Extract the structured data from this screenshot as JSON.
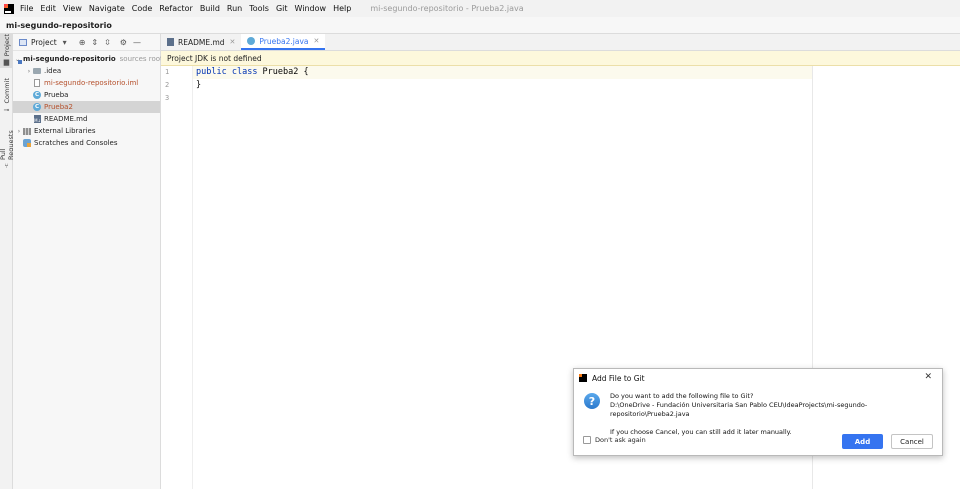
{
  "menubar": {
    "items": [
      "File",
      "Edit",
      "View",
      "Navigate",
      "Code",
      "Refactor",
      "Build",
      "Run",
      "Tools",
      "Git",
      "Window",
      "Help"
    ],
    "window_title": "mi-segundo-repositorio - Prueba2.java"
  },
  "navbar": {
    "project_name": "mi-segundo-repositorio"
  },
  "toolstrip": {
    "tabs": [
      {
        "label": "Project",
        "icon": "folder-icon"
      },
      {
        "label": "Commit",
        "icon": "commit-icon"
      },
      {
        "label": "Pull Requests",
        "icon": "pull-request-icon"
      }
    ]
  },
  "project_panel": {
    "header_label": "Project",
    "tree": {
      "root": {
        "label": "mi-segundo-repositorio",
        "hint": "sources root"
      },
      "idea": {
        "label": ".idea"
      },
      "iml": {
        "label": "mi-segundo-repositorio.iml"
      },
      "prueba": {
        "label": "Prueba"
      },
      "prueba2": {
        "label": "Prueba2"
      },
      "readme": {
        "label": "README.md"
      },
      "ext_libs": {
        "label": "External Libraries"
      },
      "scratches": {
        "label": "Scratches and Consoles"
      }
    }
  },
  "editor": {
    "tabs": [
      {
        "label": "README.md",
        "active": false
      },
      {
        "label": "Prueba2.java",
        "active": true
      }
    ],
    "banner": "Project JDK is not defined",
    "line_numbers": [
      "1",
      "2",
      "3"
    ],
    "code": {
      "line1_kw1": "public",
      "line1_kw2": "class",
      "line1_rest": " Prueba2 {",
      "line2": "}"
    }
  },
  "dialog": {
    "title": "Add File to Git",
    "question": "Do you want to add the following file to Git?",
    "path": "D:\\OneDrive - Fundación Universitaria San Pablo CEU\\IdeaProjects\\mi-segundo-repositorio\\Prueba2.java",
    "note": "If you choose Cancel, you can still add it later manually.",
    "checkbox_label": "Don't ask again",
    "add_label": "Add",
    "cancel_label": "Cancel"
  },
  "colors": {
    "accent": "#3574f0",
    "banner_bg": "#fdf8dc",
    "keyword": "#0033b3",
    "unversioned_file": "#b5502c"
  }
}
